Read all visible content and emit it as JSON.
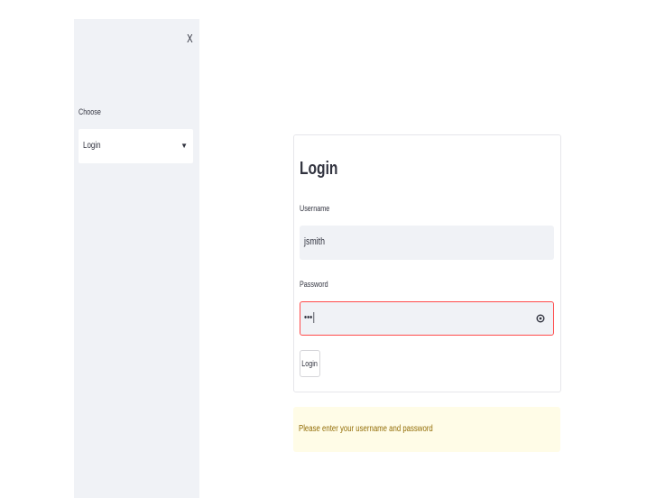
{
  "sidebar": {
    "close_label": "X",
    "select_label": "Choose",
    "select_value": "Login"
  },
  "form": {
    "title": "Login",
    "username_label": "Username",
    "username_value": "jsmith",
    "password_label": "Password",
    "password_value": "•••",
    "submit_label": "Login"
  },
  "alert": {
    "message": "Please enter your username and password"
  },
  "colors": {
    "sidebar_bg": "#f0f2f6",
    "focus_border": "#ff4b4b",
    "alert_bg": "#fffce7",
    "alert_text": "#926c05"
  },
  "icons": {
    "close": "close-icon",
    "dropdown": "chevron-down-icon",
    "reveal_password": "eye-icon"
  }
}
